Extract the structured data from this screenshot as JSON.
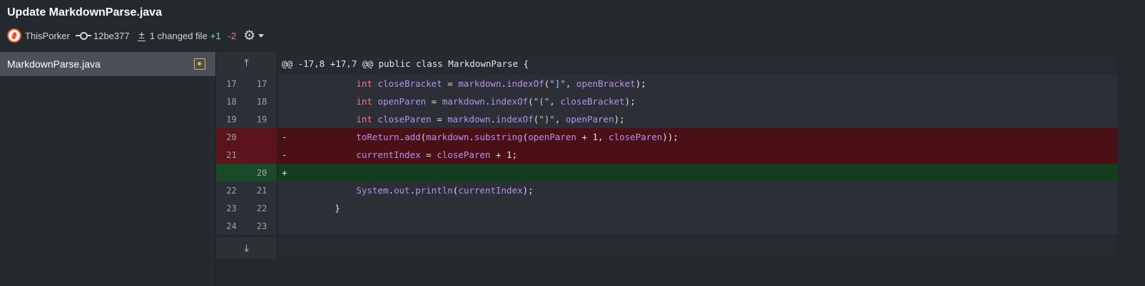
{
  "header": {
    "title": "Update MarkdownParse.java",
    "author": "ThisPorker",
    "commit_sha": "12be377",
    "changed_files": "1 changed file",
    "additions": "+1",
    "deletions": "-2"
  },
  "sidebar": {
    "file": "MarkdownParse.java"
  },
  "diff": {
    "hunk_header": "@@ -17,8 +17,7 @@ public class MarkdownParse {",
    "lines": [
      {
        "type": "ctx",
        "old": "17",
        "new": "17",
        "sign": " ",
        "indent": "            ",
        "tokens": [
          [
            "kw",
            "int"
          ],
          [
            "",
            " "
          ],
          [
            "id",
            "closeBracket"
          ],
          [
            "",
            " = "
          ],
          [
            "id",
            "markdown"
          ],
          [
            "",
            "."
          ],
          [
            "fn",
            "indexOf"
          ],
          [
            "",
            "("
          ],
          [
            "str",
            "\"]\""
          ],
          [
            "",
            ", "
          ],
          [
            "id",
            "openBracket"
          ],
          [
            "",
            ");"
          ]
        ]
      },
      {
        "type": "ctx",
        "old": "18",
        "new": "18",
        "sign": " ",
        "indent": "            ",
        "tokens": [
          [
            "kw",
            "int"
          ],
          [
            "",
            " "
          ],
          [
            "id",
            "openParen"
          ],
          [
            "",
            " = "
          ],
          [
            "id",
            "markdown"
          ],
          [
            "",
            "."
          ],
          [
            "fn",
            "indexOf"
          ],
          [
            "",
            "("
          ],
          [
            "str",
            "\"(\""
          ],
          [
            "",
            ", "
          ],
          [
            "id",
            "closeBracket"
          ],
          [
            "",
            ");"
          ]
        ]
      },
      {
        "type": "ctx",
        "old": "19",
        "new": "19",
        "sign": " ",
        "indent": "            ",
        "tokens": [
          [
            "kw",
            "int"
          ],
          [
            "",
            " "
          ],
          [
            "id",
            "closeParen"
          ],
          [
            "",
            " = "
          ],
          [
            "id",
            "markdown"
          ],
          [
            "",
            "."
          ],
          [
            "fn",
            "indexOf"
          ],
          [
            "",
            "("
          ],
          [
            "str",
            "\")\""
          ],
          [
            "",
            ", "
          ],
          [
            "id",
            "openParen"
          ],
          [
            "",
            ");"
          ]
        ]
      },
      {
        "type": "del",
        "old": "20",
        "new": "",
        "sign": "-",
        "indent": "            ",
        "tokens": [
          [
            "id",
            "toReturn"
          ],
          [
            "",
            "."
          ],
          [
            "fn",
            "add"
          ],
          [
            "",
            "("
          ],
          [
            "id",
            "markdown"
          ],
          [
            "",
            "."
          ],
          [
            "fn",
            "substring"
          ],
          [
            "",
            "("
          ],
          [
            "id",
            "openParen"
          ],
          [
            "",
            " + 1, "
          ],
          [
            "id",
            "closeParen"
          ],
          [
            "",
            "));"
          ]
        ]
      },
      {
        "type": "del",
        "old": "21",
        "new": "",
        "sign": "-",
        "indent": "            ",
        "tokens": [
          [
            "id",
            "currentIndex"
          ],
          [
            "",
            " = "
          ],
          [
            "id",
            "closeParen"
          ],
          [
            "",
            " + 1;"
          ]
        ]
      },
      {
        "type": "ins",
        "old": "",
        "new": "20",
        "sign": "+",
        "indent": "",
        "tokens": []
      },
      {
        "type": "ctx",
        "old": "22",
        "new": "21",
        "sign": " ",
        "indent": "            ",
        "tokens": [
          [
            "id",
            "System"
          ],
          [
            "",
            "."
          ],
          [
            "id",
            "out"
          ],
          [
            "",
            "."
          ],
          [
            "fn",
            "println"
          ],
          [
            "",
            "("
          ],
          [
            "id",
            "currentIndex"
          ],
          [
            "",
            ");"
          ]
        ]
      },
      {
        "type": "ctx",
        "old": "23",
        "new": "22",
        "sign": " ",
        "indent": "        ",
        "tokens": [
          [
            "",
            "}"
          ]
        ]
      },
      {
        "type": "ctx",
        "old": "24",
        "new": "23",
        "sign": " ",
        "indent": "",
        "tokens": []
      }
    ]
  },
  "colors": {
    "deleted_bg": "#4b1016",
    "inserted_bg": "#143d1e",
    "keyword": "#f97583",
    "string": "#9ecbff",
    "identifier": "#b392f0"
  }
}
